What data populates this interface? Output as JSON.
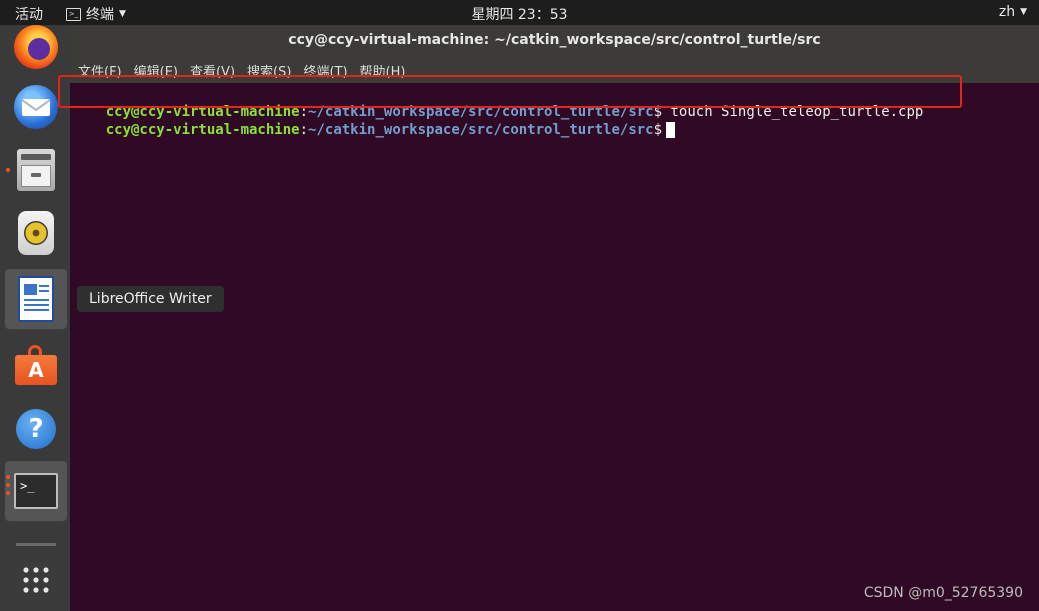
{
  "topbar": {
    "activities": "活动",
    "app_menu": "终端",
    "clock": "星期四 23：53",
    "lang": "zh"
  },
  "window": {
    "title": "ccy@ccy-virtual-machine: ~/catkin_workspace/src/control_turtle/src"
  },
  "menu": {
    "items": [
      "文件(F)",
      "编辑(E)",
      "查看(V)",
      "搜索(S)",
      "终端(T)",
      "帮助(H)"
    ]
  },
  "terminal": {
    "lines": [
      {
        "user": "ccy@ccy-virtual-machine",
        "colon": ":",
        "path": "~/catkin_workspace/src/control_turtle/src",
        "dollar": "$",
        "cmd": " touch Single_teleop_turtle.cpp"
      },
      {
        "user": "ccy@ccy-virtual-machine",
        "colon": ":",
        "path": "~/catkin_workspace/src/control_turtle/src",
        "dollar": "$",
        "cmd": ""
      }
    ]
  },
  "dock": {
    "tooltip": "LibreOffice Writer",
    "items": [
      "firefox",
      "thunderbird",
      "files",
      "rhythmbox",
      "libreoffice-writer",
      "software-center",
      "help",
      "terminal",
      "show-apps"
    ]
  },
  "colors": {
    "prompt_user": "#8ae234",
    "prompt_path": "#729fcf",
    "terminal_bg": "#300a24",
    "highlight": "#e1251b"
  },
  "watermark": "CSDN @m0_52765390"
}
